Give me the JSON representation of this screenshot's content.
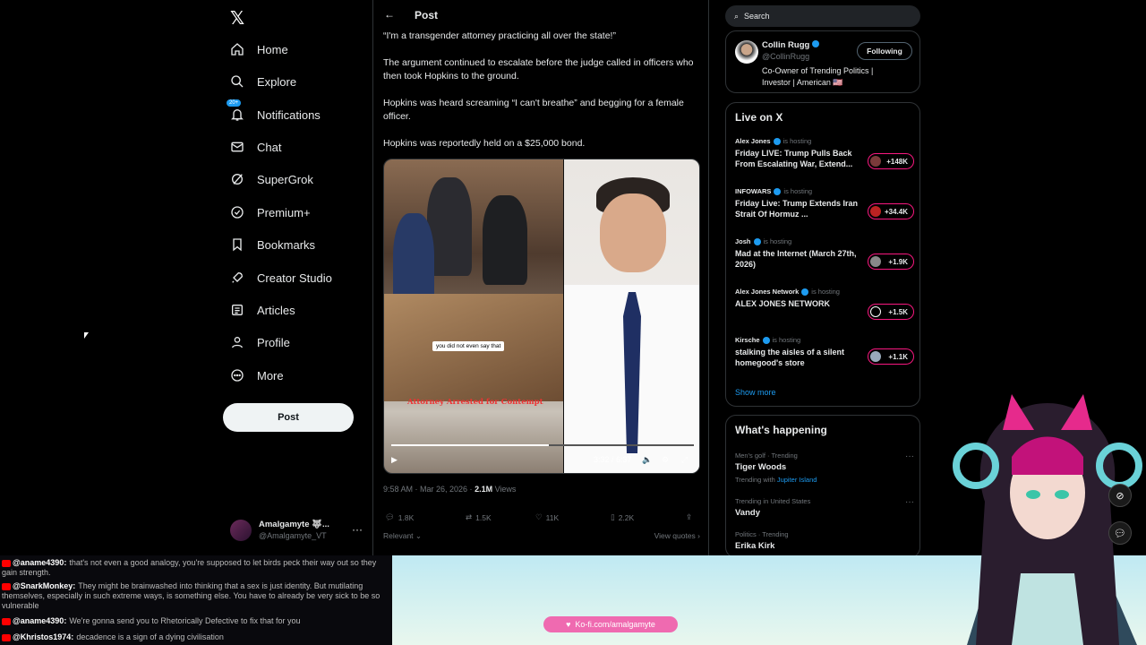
{
  "nav": {
    "logo": "𝕏",
    "notif_badge": "20+",
    "items": [
      {
        "label": "Home",
        "icon": "home-icon"
      },
      {
        "label": "Explore",
        "icon": "search-icon"
      },
      {
        "label": "Notifications",
        "icon": "bell-icon"
      },
      {
        "label": "Chat",
        "icon": "mail-icon"
      },
      {
        "label": "SuperGrok",
        "icon": "grok-icon"
      },
      {
        "label": "Premium+",
        "icon": "premium-icon"
      },
      {
        "label": "Bookmarks",
        "icon": "bookmark-icon"
      },
      {
        "label": "Creator Studio",
        "icon": "rocket-icon"
      },
      {
        "label": "Articles",
        "icon": "article-icon"
      },
      {
        "label": "Profile",
        "icon": "person-icon"
      },
      {
        "label": "More",
        "icon": "more-icon"
      }
    ],
    "post_button": "Post",
    "account": {
      "name": "Amalgamyte 🐺...",
      "handle": "@Amalgamyte_VT",
      "dots": "···"
    }
  },
  "post": {
    "back": "←",
    "title": "Post",
    "paragraphs": [
      "“I'm a transgender attorney practicing all over the state!”",
      "The argument continued to escalate before the judge called in officers who then took Hopkins to the ground.",
      "Hopkins was heard screaming “I can't breathe” and begging for a female officer.",
      "Hopkins was reportedly held on a $25,000 bond."
    ],
    "video": {
      "caption": "you did not even say that",
      "overlay_title": "Attorney Arrested for Contempt",
      "time": "3:32 / 6:37",
      "progress": 0.52
    },
    "meta": {
      "time": "9:58 AM · Mar 26, 2026 · ",
      "views": "2.1M",
      "views_label": " Views"
    },
    "actions": {
      "replies": "1.8K",
      "reposts": "1.5K",
      "likes": "11K",
      "bookmarks": "2.2K"
    },
    "relevant": "Relevant ⌄",
    "view_quotes": "View quotes ›"
  },
  "right": {
    "search_placeholder": "Search",
    "profile": {
      "name": "Collin Rugg",
      "handle": "@CollinRugg",
      "bio": "Co-Owner of Trending Politics | Investor | American 🇺🇸",
      "follow": "Following"
    },
    "live": {
      "title": "Live on X",
      "hosting_label": "is hosting",
      "items": [
        {
          "host": "Alex Jones",
          "title": "Friday LIVE: Trump Pulls Back From Escalating War, Extend...",
          "count": "+148K"
        },
        {
          "host": "INFOWARS",
          "title": "Friday Live: Trump Extends Iran Strait Of Hormuz ...",
          "count": "+34.4K"
        },
        {
          "host": "Josh",
          "title": "Mad at the Internet (March 27th, 2026)",
          "count": "+1.9K"
        },
        {
          "host": "Alex Jones Network",
          "title": "ALEX JONES NETWORK",
          "count": "+1.5K"
        },
        {
          "host": "Kirsche",
          "title": "stalking the aisles of a silent homegood's store",
          "count": "+1.1K"
        }
      ],
      "show_more": "Show more"
    },
    "happening": {
      "title": "What's happening",
      "trends": [
        {
          "category": "Men's golf · Trending",
          "name": "Tiger Woods",
          "with_label": "Trending with ",
          "with": "Jupiter Island"
        },
        {
          "category": "Trending in United States",
          "name": "Vandy"
        },
        {
          "category": "Politics · Trending",
          "name": "Erika Kirk"
        }
      ]
    }
  },
  "stream": {
    "chat": [
      {
        "user": "@aname4390:",
        "msg": "that's not even a good analogy, you're supposed to let birds peck their way out so they gain strength."
      },
      {
        "user": "@SnarkMonkey:",
        "msg": "They might be brainwashed into thinking that a sex is just identity. But mutilating themselves, especially in such extreme ways, is something else. You have to already be very sick to be so vulnerable"
      },
      {
        "user": "@aname4390:",
        "msg": "We're gonna send you to Rhetorically Defective to fix that for you"
      },
      {
        "user": "@Khristos1974:",
        "msg": "decadence is a sign of a dying civilisation"
      }
    ],
    "kofi": "Ko-fi.com/amalgamyte"
  }
}
